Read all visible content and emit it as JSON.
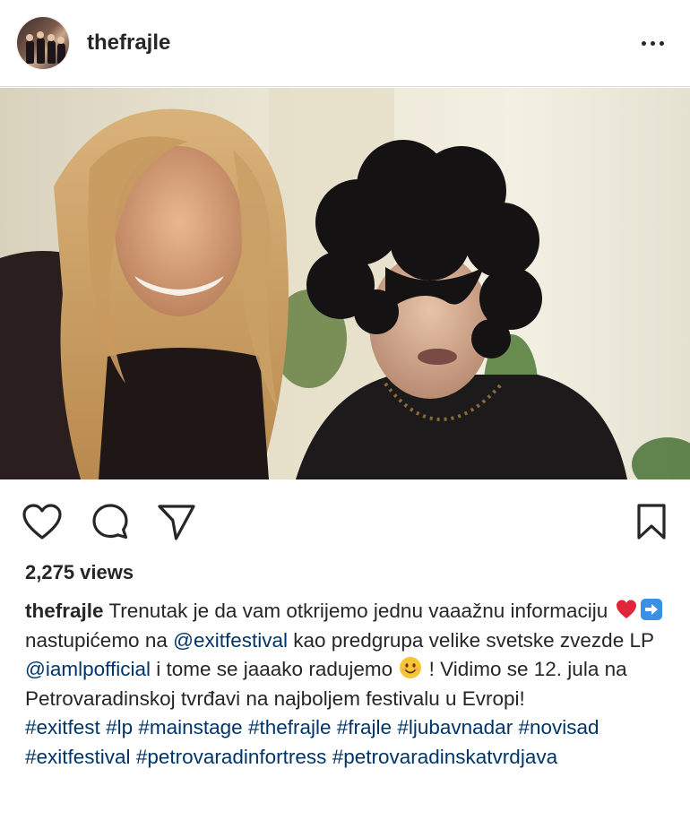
{
  "post": {
    "username": "thefrajle",
    "avatar_icon": "profile-photo",
    "more_icon": "ellipsis-icon",
    "views": "2,275 views",
    "caption": {
      "username": "thefrajle",
      "text1": " Trenutak je da vam otkrijemo jednu vaaažnu informaciju ",
      "emoji1": "heart-emoji",
      "emoji2": "right-arrow-emoji",
      "text2": " nastupićemo na ",
      "mention1": "@exitfestival",
      "text3": " kao predgrupa velike svetske zvezde LP ",
      "mention2": "@iamlpofficial",
      "text4": " i tome se jaaako radujemo ",
      "emoji3": "smiling-face-emoji",
      "text5": " ! Vidimo se 12. jula na Petrovaradinskoj tvrđavi na najboljem festivalu u Evropi!",
      "hashtags": [
        "#exitfest",
        "#lp",
        "#mainstage",
        "#thefrajle",
        "#frajle",
        "#ljubavnadar",
        "#novisad",
        "#exitfestival",
        "#petrovaradinfortress",
        "#petrovaradinskatvrdjava"
      ]
    }
  },
  "actions": {
    "like_icon": "heart-outline-icon",
    "comment_icon": "comment-icon",
    "share_icon": "paper-plane-icon",
    "save_icon": "bookmark-icon"
  },
  "colors": {
    "text": "#262626",
    "link": "#003569",
    "divider": "#dbdbdb",
    "heart_emoji": "#e0243a",
    "arrow_emoji": "#3a8fe6",
    "smile_emoji": "#f7c531"
  }
}
